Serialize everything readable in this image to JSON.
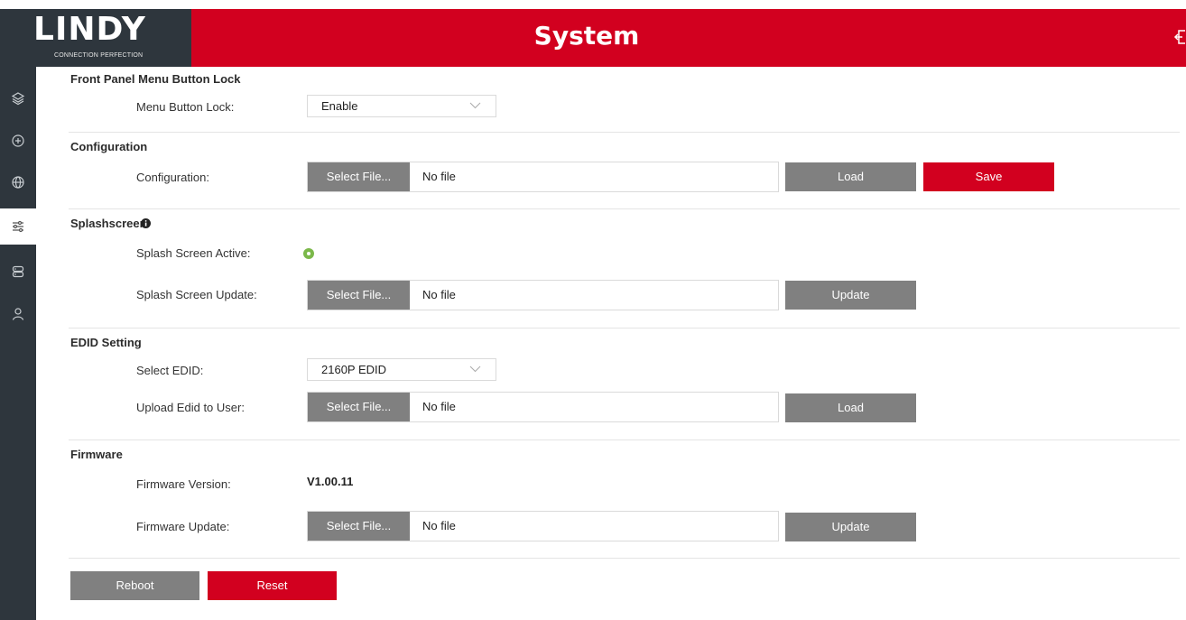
{
  "header": {
    "logo_text": "LINDY",
    "logo_tagline": "CONNECTION PERFECTION",
    "title": "System",
    "logout_icon": "logout-icon",
    "brand_color": "#d2001f",
    "dark_color": "#2e363d"
  },
  "sidebar": {
    "items": [
      {
        "icon": "layers-icon",
        "active": false
      },
      {
        "icon": "target-icon",
        "active": false
      },
      {
        "icon": "globe-icon",
        "active": false
      },
      {
        "icon": "sliders-icon",
        "active": true
      },
      {
        "icon": "server-icon",
        "active": false
      },
      {
        "icon": "user-icon",
        "active": false
      }
    ]
  },
  "front_panel": {
    "title": "Front Panel Menu Button Lock",
    "lock_label": "Menu Button Lock:",
    "lock_value": "Enable"
  },
  "configuration": {
    "title": "Configuration",
    "label": "Configuration:",
    "select_file": "Select File...",
    "file_name": "No file",
    "load_label": "Load",
    "save_label": "Save"
  },
  "splashscreen": {
    "title": "Splashscreen",
    "active_label": "Splash Screen Active:",
    "update_label": "Splash Screen Update:",
    "select_file": "Select File...",
    "file_name": "No file",
    "update_button": "Update",
    "active_color": "#7bb84a"
  },
  "edid": {
    "title": "EDID Setting",
    "select_label": "Select EDID:",
    "select_value": "2160P EDID",
    "upload_label": "Upload Edid to User:",
    "select_file": "Select File...",
    "file_name": "No file",
    "load_label": "Load"
  },
  "firmware": {
    "title": "Firmware",
    "version_label": "Firmware Version:",
    "version_value": "V1.00.11",
    "update_label": "Firmware Update:",
    "select_file": "Select File...",
    "file_name": "No file",
    "update_button": "Update"
  },
  "actions": {
    "reboot_label": "Reboot",
    "reset_label": "Reset"
  }
}
